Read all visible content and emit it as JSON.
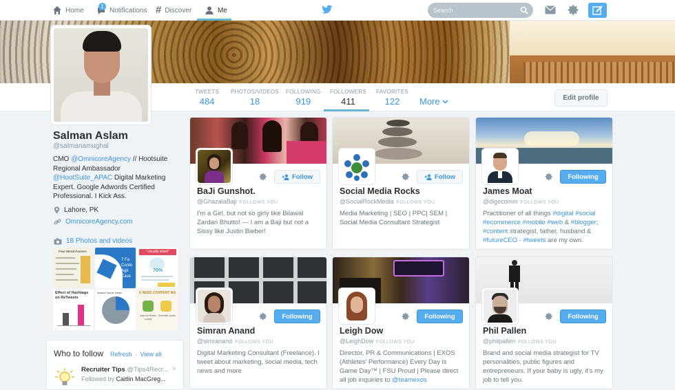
{
  "nav": {
    "home": "Home",
    "notifications": "Notifications",
    "notifications_count": "1",
    "discover": "Discover",
    "me": "Me",
    "search_placeholder": "Search"
  },
  "profile_nav": {
    "tweets_label": "TWEETS",
    "tweets_value": "484",
    "photos_label": "PHOTOS/VIDEOS",
    "photos_value": "18",
    "following_label": "FOLLOWING",
    "following_value": "919",
    "followers_label": "FOLLOWERS",
    "followers_value": "411",
    "favorites_label": "FAVORITES",
    "favorites_value": "122",
    "more_label": "More",
    "edit_profile": "Edit profile"
  },
  "profile": {
    "name": "Salman Aslam",
    "handle": "@salmanamughal",
    "bio_1": "CMO ",
    "bio_link_1": "@OmnicoreAgency",
    "bio_2": " // Hootsuite Regional Ambassador ",
    "bio_link_2": "@HootSuite_APAC",
    "bio_3": " Digital Marketing Expert. Google Adwords Certified Professional. I Kick Ass.",
    "location": "Lahore, PK",
    "url": "OmnicoreAgency.com",
    "photos_link": "18 Photos and videos"
  },
  "who_to_follow": {
    "title": "Who to follow",
    "refresh": "Refresh",
    "separator": "·",
    "view_all": "View all",
    "suggestion_name": "Recruiter Tips",
    "suggestion_handle": "@Tips4Recr...",
    "followed_by_prefix": "Followed by ",
    "followed_by_name": "Caitlin MacGreg...",
    "close": "×"
  },
  "cards": [
    {
      "name": "BaJi Gunshot.",
      "handle": "@GhazalaBaji",
      "follows_you": "FOLLOWS YOU",
      "button": "Follow",
      "bio": "I'm a Girl, but not so girly like Bilawal Zardari Bhutto! — I am a Baji but not a Sissy like Justin Bieber!"
    },
    {
      "name": "Social Media Rocks",
      "handle": "@SocialRockMedia",
      "follows_you": "FOLLOWS YOU",
      "button": "Follow",
      "bio": "Media Marketing | SEO | PPC| SEM | Social Media Consultant Strategist"
    },
    {
      "name": "James Moat",
      "handle": "@digecomm",
      "follows_you": "FOLLOWS YOU",
      "button": "Following",
      "bio_parts": [
        "Practitioner of all things ",
        "#digital",
        " ",
        "#social",
        " ",
        "#ecommerce",
        " ",
        "#mobile",
        " ",
        "#web",
        " & ",
        "#blogger",
        "; ",
        "#content",
        " strategist, father, husband & ",
        "#futureCEO",
        " - ",
        "#tweets",
        " are my own."
      ]
    },
    {
      "name": "Simran Anand",
      "handle": "@simranand",
      "follows_you": "FOLLOWS YOU",
      "button": "Following",
      "bio": "Digital Marketing Consultant (Freelance). I tweet about marketing, social media, tech news and more"
    },
    {
      "name": "Leigh Dow",
      "handle": "@LeighDow",
      "follows_you": "FOLLOWS YOU",
      "button": "Following",
      "bio_parts": [
        "Director, PR & Communications | EXOS (Athletes' Performance) Every Day is Game Day™ | FSU Proud | Please direct all job inquiries to ",
        "@teamexos"
      ]
    },
    {
      "name": "Phil Pallen",
      "handle": "@philpallen",
      "follows_you": "FOLLOWS YOU",
      "button": "Following",
      "bio": "Brand and social media strategist for TV personalities, public figures and entrepreneurs. If your baby is ugly, it's my job to tell you."
    }
  ],
  "thumbnail_text": {
    "t1_title": "Four Mood Factors",
    "t2_text": "7 Fa Conte Agil Case",
    "t3_title": "\"visually wired\"",
    "t3_stat": "70%",
    "t4_title": "Effect of Hashtags on ReTweets",
    "t4_hashtag": "Hashtags",
    "t5_title": "Instant Sports Heart",
    "t6_title": "U NEED CONTENT MA",
    "t6_a": "Improve Brand Loyalty",
    "t6_b": "Generate Leads"
  },
  "colors": {
    "accent": "#55acee",
    "link": "#3b94d9",
    "text": "#292f33",
    "muted": "#8899a6"
  }
}
